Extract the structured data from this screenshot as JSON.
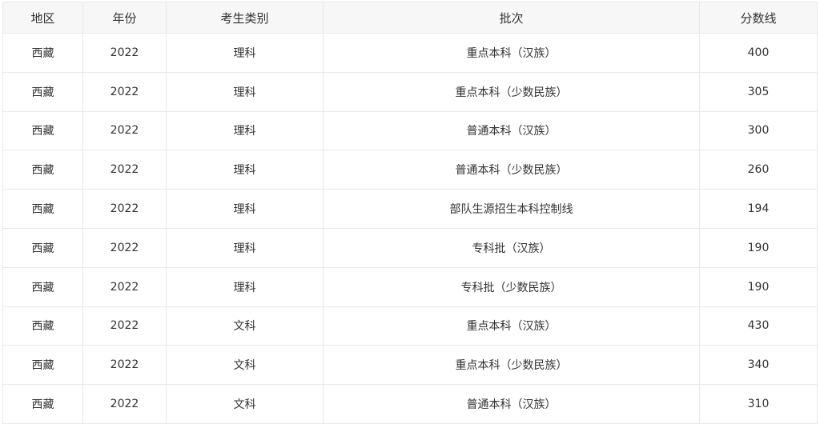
{
  "table": {
    "headers": [
      "地区",
      "年份",
      "考生类别",
      "批次",
      "分数线"
    ],
    "rows": [
      [
        "西藏",
        "2022",
        "理科",
        "重点本科（汉族）",
        "400"
      ],
      [
        "西藏",
        "2022",
        "理科",
        "重点本科（少数民族）",
        "305"
      ],
      [
        "西藏",
        "2022",
        "理科",
        "普通本科（汉族）",
        "300"
      ],
      [
        "西藏",
        "2022",
        "理科",
        "普通本科（少数民族）",
        "260"
      ],
      [
        "西藏",
        "2022",
        "理科",
        "部队生源招生本科控制线",
        "194"
      ],
      [
        "西藏",
        "2022",
        "理科",
        "专科批（汉族）",
        "190"
      ],
      [
        "西藏",
        "2022",
        "理科",
        "专科批（少数民族）",
        "190"
      ],
      [
        "西藏",
        "2022",
        "文科",
        "重点本科（汉族）",
        "430"
      ],
      [
        "西藏",
        "2022",
        "文科",
        "重点本科（少数民族）",
        "340"
      ],
      [
        "西藏",
        "2022",
        "文科",
        "普通本科（汉族）",
        "310"
      ]
    ]
  }
}
